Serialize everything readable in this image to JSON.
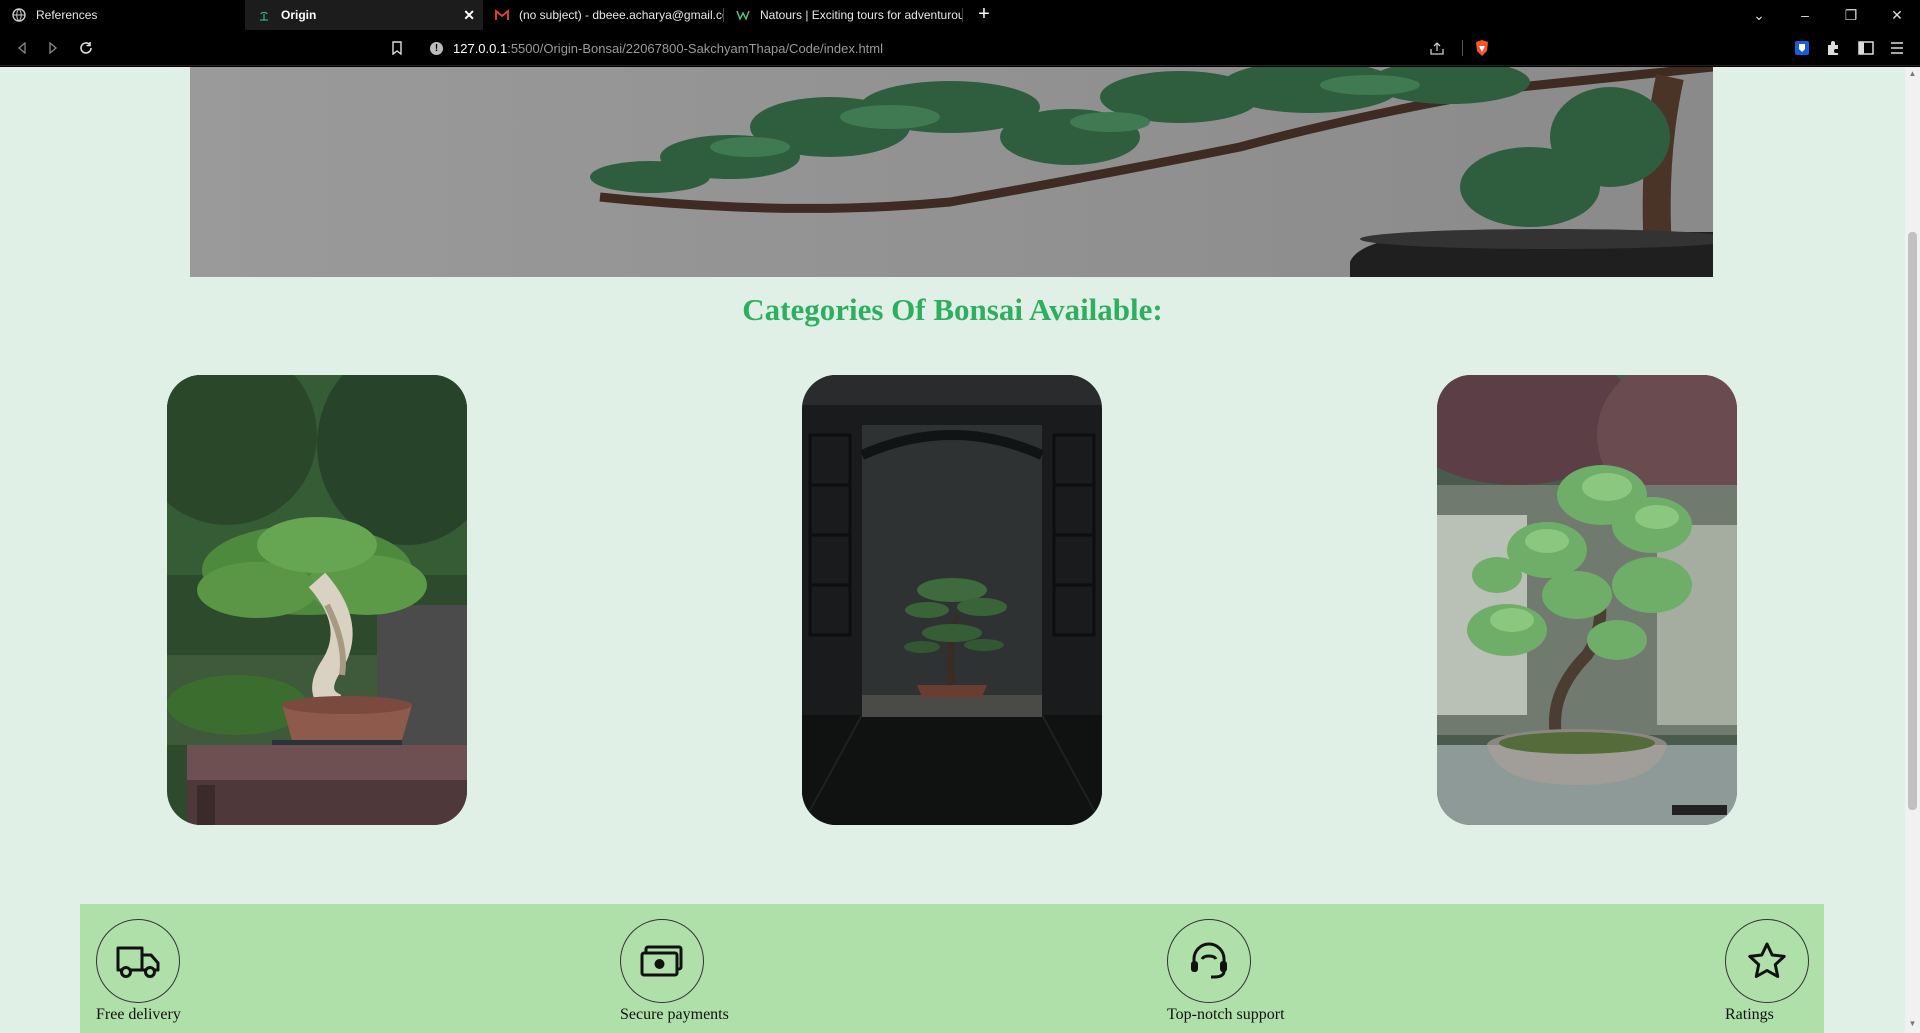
{
  "browser": {
    "tabs": [
      {
        "title": "References",
        "active": false,
        "icon": "globe-icon"
      },
      {
        "title": "Origin",
        "active": true,
        "icon": "bonsai-favicon-icon"
      },
      {
        "title": "(no subject) - dbeee.acharya@gmail.co",
        "active": false,
        "icon": "gmail-icon"
      },
      {
        "title": "Natours | Exciting tours for adventurou",
        "active": false,
        "icon": "natours-icon"
      }
    ],
    "url_host": "127.0.0.1",
    "url_path": ":5500/Origin-Bonsai/22067800-SakchyamThapa/Code/index.html"
  },
  "page": {
    "categories_title": "Categories Of Bonsai Available:",
    "features": [
      {
        "label": "Free delivery",
        "icon": "truck-icon"
      },
      {
        "label": "Secure payments",
        "icon": "cash-icon"
      },
      {
        "label": "Top-notch support",
        "icon": "headset-icon"
      },
      {
        "label": "Ratings",
        "icon": "star-icon"
      }
    ]
  },
  "colors": {
    "page_background": "#e0f0e7",
    "title_green": "#2fae5f",
    "features_band": "#afe0a9"
  }
}
